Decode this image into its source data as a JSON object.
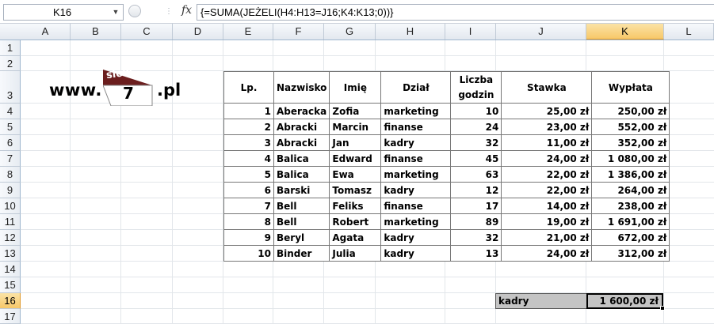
{
  "formula_bar": {
    "name_box": "K16",
    "fx_label": "fx",
    "formula": "{=SUMA(JEŻELI(H4:H13=J16;K4:K13;0))}"
  },
  "columns": [
    "A",
    "B",
    "C",
    "D",
    "E",
    "F",
    "G",
    "H",
    "I",
    "J",
    "K",
    "L"
  ],
  "selected_column": "K",
  "rows": [
    "1",
    "2",
    "3",
    "4",
    "5",
    "6",
    "7",
    "8",
    "9",
    "10",
    "11",
    "12",
    "13",
    "14",
    "15",
    "16",
    "17"
  ],
  "selected_row": "16",
  "logo": {
    "prefix": "www.",
    "word": "slow",
    "digit": "7",
    "suffix": ".pl"
  },
  "table": {
    "headers": [
      "Lp.",
      "Nazwisko",
      "Imię",
      "Dział",
      "Liczba godzin",
      "Stawka",
      "Wypłata"
    ],
    "rows": [
      [
        "1",
        "Aberacka",
        "Zofia",
        "marketing",
        "10",
        "25,00 zł",
        "250,00 zł"
      ],
      [
        "2",
        "Abracki",
        "Marcin",
        "finanse",
        "24",
        "23,00 zł",
        "552,00 zł"
      ],
      [
        "3",
        "Abracki",
        "Jan",
        "kadry",
        "32",
        "11,00 zł",
        "352,00 zł"
      ],
      [
        "4",
        "Balica",
        "Edward",
        "finanse",
        "45",
        "24,00 zł",
        "1 080,00 zł"
      ],
      [
        "5",
        "Balica",
        "Ewa",
        "marketing",
        "63",
        "22,00 zł",
        "1 386,00 zł"
      ],
      [
        "6",
        "Barski",
        "Tomasz",
        "kadry",
        "12",
        "22,00 zł",
        "264,00 zł"
      ],
      [
        "7",
        "Bell",
        "Feliks",
        "finanse",
        "17",
        "14,00 zł",
        "238,00 zł"
      ],
      [
        "8",
        "Bell",
        "Robert",
        "marketing",
        "89",
        "19,00 zł",
        "1 691,00 zł"
      ],
      [
        "9",
        "Beryl",
        "Agata",
        "kadry",
        "32",
        "21,00 zł",
        "672,00 zł"
      ],
      [
        "10",
        "Binder",
        "Julia",
        "kadry",
        "13",
        "24,00 zł",
        "312,00 zł"
      ]
    ]
  },
  "result": {
    "criteria": "kadry",
    "value": "1 600,00 zł"
  }
}
